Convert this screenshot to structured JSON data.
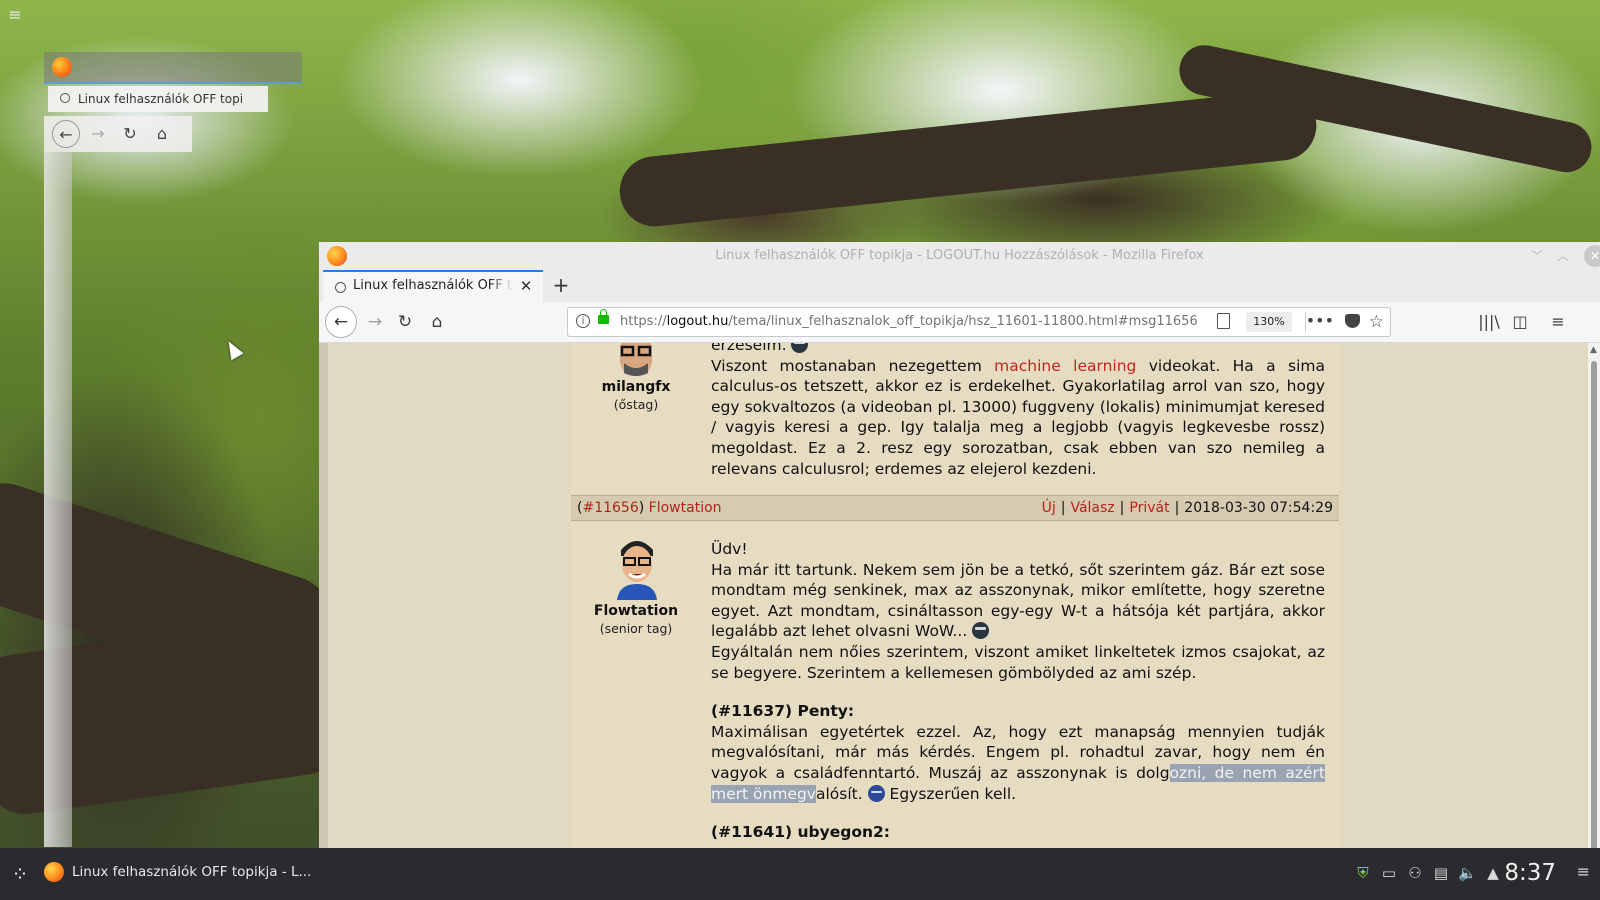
{
  "desktop": {
    "menu_icon": "hamburger-icon",
    "cursor_icon": "mouse-pointer-icon"
  },
  "ghost_window": {
    "tab_label": "Linux felhasználók OFF topi",
    "nav_icons": [
      "back-arrow-icon",
      "forward-arrow-icon",
      "reload-icon",
      "home-icon"
    ]
  },
  "firefox": {
    "window_title": "Linux felhasználók OFF topikja - LOGOUT.hu Hozzászólások - Mozilla Firefox",
    "tab_label": "Linux felhasználók OFF topikja - LOGOUT.hu Hozzászólások",
    "new_tab": "+",
    "url_prefix": "https://",
    "url_domain": "logout.hu",
    "url_path": "/tema/linux_felhasznalok_off_topikja/hsz_11601-11800.html#msg11656",
    "zoom": "130%",
    "more": "•••",
    "accent": "#0a84ff"
  },
  "page": {
    "prev_post": {
      "username": "milangfx",
      "rank": "(őstag)",
      "partial_top": "erzeseim.",
      "text_before_link": "Viszont mostanaban nezegettem ",
      "link": "machine learning",
      "text_after_link": " videokat. Ha a sima calculus-os tetszett, akkor ez is erdekelhet. Gyakorlatilag arrol van szo, hogy egy sokvaltozos (a videoban pl. 13000) fuggveny (lokalis) minimumjat keresed / vagyis keresi a gep. Igy talalja meg a legjobb (vagyis legkevesbe rossz) megoldast. Ez a 2. resz egy sorozatban, csak ebben van szo nemileg a relevans calculusrol; erdemes az elejerol kezdeni."
    },
    "post": {
      "number": "#11656",
      "author": "Flowtation",
      "actions": [
        "Új",
        "Válasz",
        "Privát"
      ],
      "date": "2018-03-30 07:54:29",
      "username": "Flowtation",
      "rank": "(senior tag)",
      "greeting": "Üdv!",
      "para1": "Ha már itt tartunk. Nekem sem jön be a tetkó, sőt szerintem gáz. Bár ezt sose mondtam még senkinek, max az asszonynak, mikor említette, hogy szeretne egyet. Azt mondtam, csináltasson egy-egy W-t a hátsója két partjára, akkor legalább azt lehet olvasni WoW...",
      "para2": "Egyáltalán nem nőies szerintem, viszont amiket linkeltetek izmos csajokat, az se begyere. Szerintem a kellemesen gömbölyded az ami szép.",
      "quote1_head": "(#11637) Penty:",
      "quote1_text_a": "Maximálisan egyetértek ezzel. Az, hogy ezt manapság mennyien tudják megvalósítani, már más kérdés. Engem pl. rohadtul zavar, hogy nem én vagyok a családfenntartó. Muszáj az asszonynak is dolg",
      "quote1_selected": "ozni, de nem azért mert önmegv",
      "quote1_text_b": "alósít.",
      "quote1_tail": " Egyszerűen kell.",
      "quote2_head": "(#11641) ubyegon2:"
    }
  },
  "taskbar": {
    "task_label": "Linux felhasználók OFF topikja - L...",
    "clock": "8:37",
    "tray_icons": [
      "shield-icon",
      "network-icon",
      "user-icon",
      "clipboard-icon",
      "volume-icon",
      "expand-up-icon"
    ]
  }
}
